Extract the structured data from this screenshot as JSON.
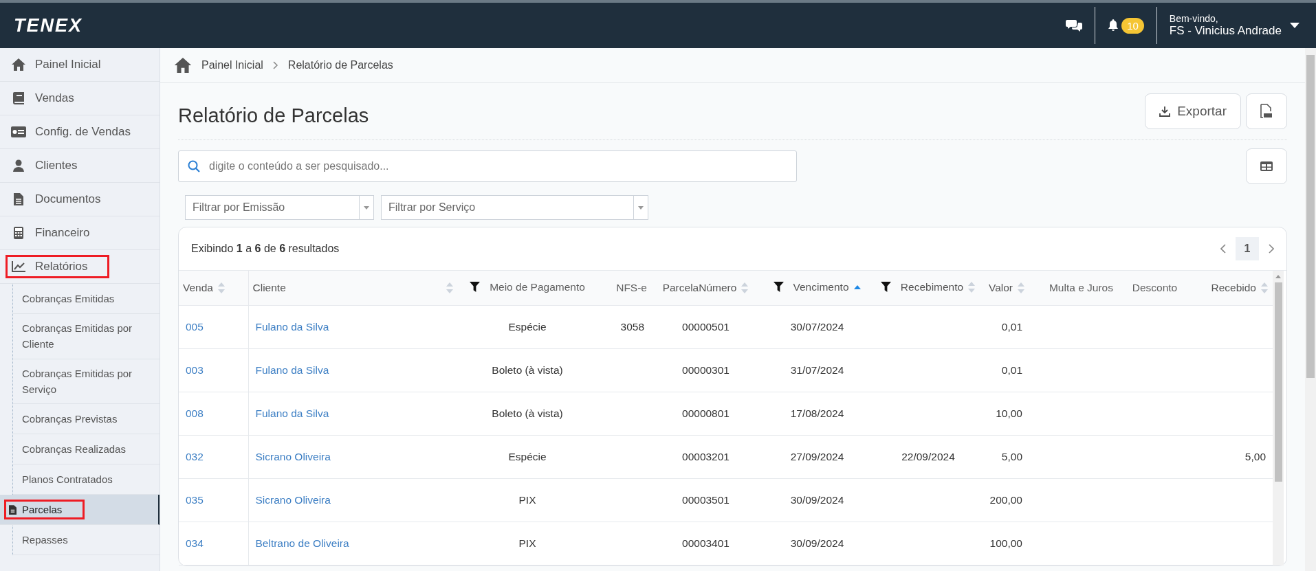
{
  "topbar": {
    "logo": "TENEX",
    "notifications": {
      "count": "10"
    },
    "user": {
      "greeting": "Bem-vindo,",
      "name": "FS - Vinicius Andrade"
    }
  },
  "sidebar": {
    "items": [
      {
        "label": "Painel Inicial",
        "selected": false,
        "highlighted": false
      },
      {
        "label": "Vendas",
        "selected": false,
        "highlighted": false
      },
      {
        "label": "Config. de Vendas",
        "selected": false,
        "highlighted": false
      },
      {
        "label": "Clientes",
        "selected": false,
        "highlighted": false
      },
      {
        "label": "Documentos",
        "selected": false,
        "highlighted": false
      },
      {
        "label": "Financeiro",
        "selected": false,
        "highlighted": false
      },
      {
        "label": "Relatórios",
        "selected": false,
        "highlighted": true,
        "expanded": true,
        "children": [
          {
            "label": "Cobranças Emitidas",
            "selected": false,
            "highlighted": false
          },
          {
            "label": "Cobranças Emitidas por Cliente",
            "selected": false,
            "highlighted": false
          },
          {
            "label": "Cobranças Emitidas por Serviço",
            "selected": false,
            "highlighted": false
          },
          {
            "label": "Cobranças Previstas",
            "selected": false,
            "highlighted": false
          },
          {
            "label": "Cobranças Realizadas",
            "selected": false,
            "highlighted": false
          },
          {
            "label": "Planos Contratados",
            "selected": false,
            "highlighted": false
          },
          {
            "label": "Parcelas",
            "selected": true,
            "highlighted": true
          },
          {
            "label": "Repasses",
            "selected": false,
            "highlighted": false
          }
        ]
      }
    ]
  },
  "breadcrumb": [
    "Painel Inicial",
    "Relatório de Parcelas"
  ],
  "title": "Relatório de Parcelas",
  "actions": {
    "export": "Exportar"
  },
  "search": {
    "placeholder": "digite o conteúdo a ser pesquisado..."
  },
  "filters": [
    {
      "placeholder": "Filtrar por Emissão"
    },
    {
      "placeholder": "Filtrar por Serviço"
    }
  ],
  "summary": "Exibindo **1** a **6** de **6** resultados",
  "pagination": {
    "pages": [
      {
        "label": "1",
        "selected": true
      }
    ]
  },
  "table": {
    "columns": [
      {
        "label": "Venda",
        "filter": false,
        "sortable": true,
        "sorted_ascending": false
      },
      {
        "label": "Cliente",
        "filter": false,
        "sortable": true,
        "sorted_ascending": false
      },
      {
        "label": "Meio de Pagamento",
        "filter": true,
        "sortable": false
      },
      {
        "label": "NFS-e",
        "filter": false,
        "sortable": false
      },
      {
        "label": "ParcelaNúmero",
        "filter": false,
        "sortable": true,
        "sorted_ascending": false
      },
      {
        "label": "Vencimento",
        "filter": true,
        "sortable": true,
        "sorted_ascending": true
      },
      {
        "label": "Recebimento",
        "filter": true,
        "sortable": true,
        "sorted_ascending": false
      },
      {
        "label": "Valor",
        "filter": false,
        "sortable": true,
        "sorted_ascending": false
      },
      {
        "label": "Multa e Juros",
        "filter": false,
        "sortable": false
      },
      {
        "label": "Desconto",
        "filter": false,
        "sortable": false
      },
      {
        "label": "Recebido",
        "filter": false,
        "sortable": true,
        "sorted_ascending": false
      }
    ],
    "rows": [
      {
        "venda": "005",
        "cliente": "Fulano da Silva",
        "meio": "Espécie",
        "nfse": "3058",
        "parcela": "00000501",
        "vencimento": "30/07/2024",
        "valor": "0,01"
      },
      {
        "venda": "003",
        "cliente": "Fulano da Silva",
        "meio": "Boleto (à vista)",
        "parcela": "00000301",
        "vencimento": "31/07/2024",
        "valor": "0,01"
      },
      {
        "venda": "008",
        "cliente": "Fulano da Silva",
        "meio": "Boleto (à vista)",
        "parcela": "00000801",
        "vencimento": "17/08/2024",
        "valor": "10,00"
      },
      {
        "venda": "032",
        "cliente": "Sicrano Oliveira",
        "meio": "Espécie",
        "parcela": "00003201",
        "vencimento": "27/09/2024",
        "recebimento": "22/09/2024",
        "valor": "5,00",
        "recebido": "5,00"
      },
      {
        "venda": "035",
        "cliente": "Sicrano Oliveira",
        "meio": "PIX",
        "parcela": "00003501",
        "vencimento": "30/09/2024",
        "valor": "200,00"
      },
      {
        "venda": "034",
        "cliente": "Beltrano de Oliveira",
        "meio": "PIX",
        "parcela": "00003401",
        "vencimento": "30/09/2024",
        "valor": "100,00"
      }
    ]
  }
}
